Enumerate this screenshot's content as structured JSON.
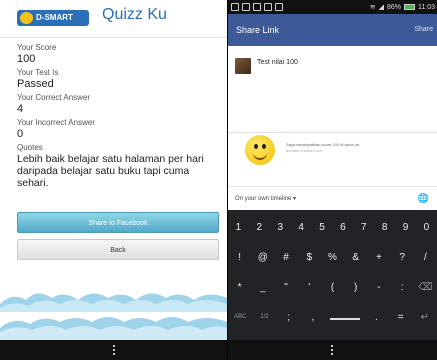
{
  "left_app": {
    "logo_text": "D-SMART",
    "title": "Quizz Ku",
    "fields": [
      {
        "label": "Your Score",
        "value": "100"
      },
      {
        "label": "Your Test Is",
        "value": "Passed"
      },
      {
        "label": "Your Correct Answer",
        "value": "4"
      },
      {
        "label": "Your Incorrect Answer",
        "value": "0"
      }
    ],
    "quotes_label": "Quotes",
    "quote_text": "Lebih baik belajar satu halaman per hari daripada belajar satu buku tapi cuma sehari.",
    "share_button": "Share to Facebook",
    "back_button": "Back"
  },
  "right_app": {
    "status": {
      "battery": "86%",
      "time": "11:03"
    },
    "header_title": "Share Link",
    "header_action": "Share",
    "post_text": "Test nilai 100",
    "preview_title": "Saya mendapatkan score 100 di quizz ini",
    "preview_sub": "domain.d-smart.com",
    "audience": "On your own timeline",
    "audience_caret": "▾",
    "globe_icon": "🌐",
    "keyboard_rows": [
      [
        "1",
        "2",
        "3",
        "4",
        "5",
        "6",
        "7",
        "8",
        "9",
        "0"
      ],
      [
        "!",
        "@",
        "#",
        "$",
        "%",
        "&",
        "+",
        "?",
        "/"
      ],
      [
        "*",
        "_",
        "\"",
        "'",
        "(",
        ")",
        "-",
        ":",
        "⌫"
      ],
      [
        "ABC",
        "1/2",
        ";",
        ",",
        " ",
        ".",
        "=",
        "↵"
      ]
    ]
  },
  "colors": {
    "fb_blue": "#3d5998",
    "accent_blue": "#2a6fb8",
    "share_button": "#6bbfd8"
  }
}
